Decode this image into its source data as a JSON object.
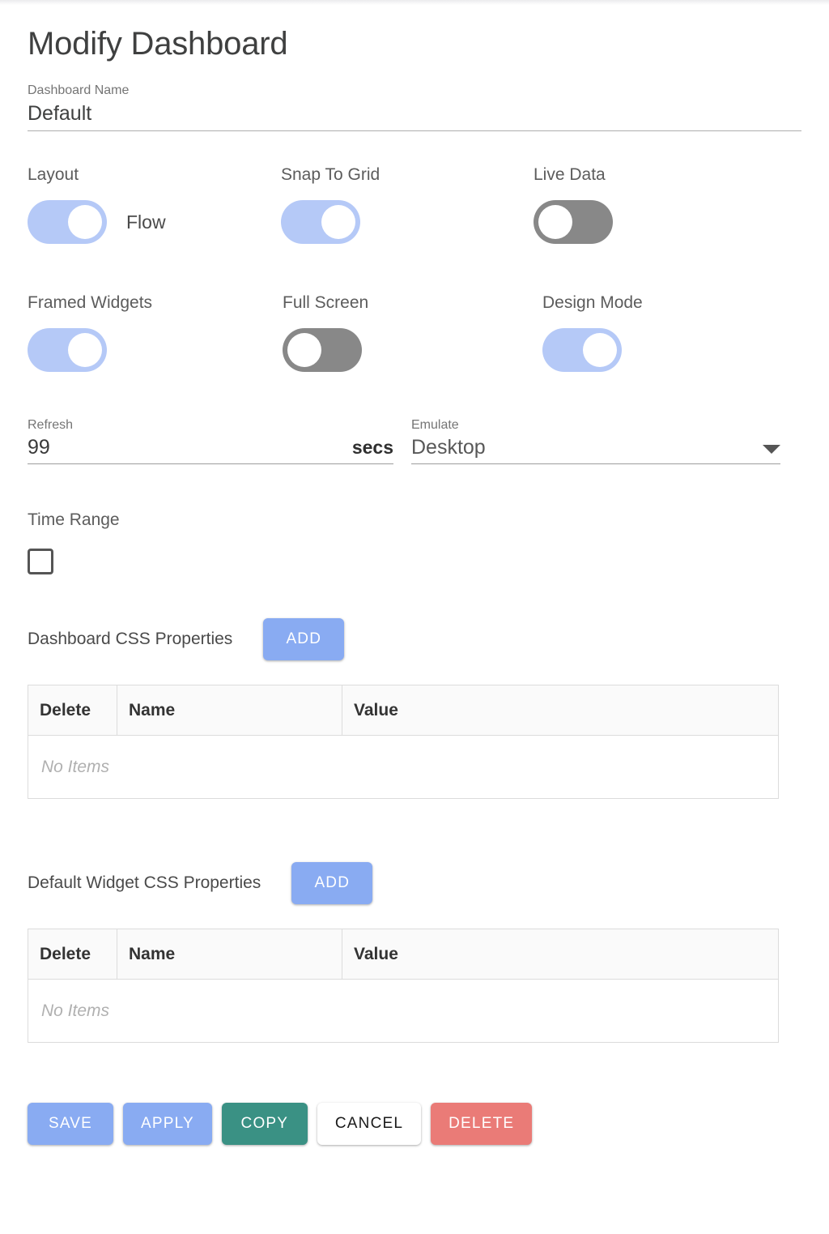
{
  "page": {
    "title": "Modify Dashboard"
  },
  "dashboard_name": {
    "label": "Dashboard Name",
    "value": "Default"
  },
  "toggles_row1": [
    {
      "label": "Layout",
      "state": "on",
      "value": "Flow"
    },
    {
      "label": "Snap To Grid",
      "state": "on",
      "value": ""
    },
    {
      "label": "Live Data",
      "state": "off",
      "value": ""
    }
  ],
  "toggles_row2": [
    {
      "label": "Framed Widgets",
      "state": "on",
      "value": ""
    },
    {
      "label": "Full Screen",
      "state": "off",
      "value": ""
    },
    {
      "label": "Design Mode",
      "state": "on",
      "value": ""
    }
  ],
  "refresh": {
    "label": "Refresh",
    "value": "99",
    "suffix": "secs"
  },
  "emulate": {
    "label": "Emulate",
    "value": "Desktop",
    "icon": "chevron-down-icon"
  },
  "time_range": {
    "label": "Time Range",
    "checked": false
  },
  "dashboard_css": {
    "title": "Dashboard CSS Properties",
    "add_label": "ADD",
    "columns": [
      "Delete",
      "Name",
      "Value"
    ],
    "empty_text": "No Items",
    "rows": []
  },
  "widget_css": {
    "title": "Default Widget CSS Properties",
    "add_label": "ADD",
    "columns": [
      "Delete",
      "Name",
      "Value"
    ],
    "empty_text": "No Items",
    "rows": []
  },
  "footer": {
    "save": "SAVE",
    "apply": "APPLY",
    "copy": "COPY",
    "cancel": "CANCEL",
    "delete": "DELETE"
  },
  "colors": {
    "accent_blue": "#89abf2",
    "toggle_on": "#b5c9f7",
    "toggle_off": "#888888",
    "copy_green": "#3a9184",
    "delete_red": "#ea7b77",
    "text_dark": "#3f4040",
    "text_muted": "#757575"
  }
}
